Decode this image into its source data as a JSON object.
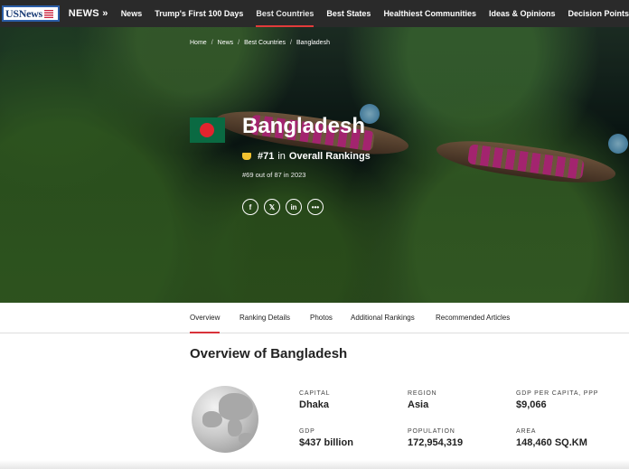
{
  "nav": {
    "logo": "USNews",
    "section": "NEWS »",
    "items": [
      {
        "label": "News",
        "active": false
      },
      {
        "label": "Trump's First 100 Days",
        "active": false
      },
      {
        "label": "Best Countries",
        "active": true
      },
      {
        "label": "Best States",
        "active": false
      },
      {
        "label": "Healthiest Communities",
        "active": false
      },
      {
        "label": "Ideas & Opinions",
        "active": false
      },
      {
        "label": "Decision Points",
        "active": false
      }
    ]
  },
  "breadcrumb": [
    "Home",
    "News",
    "Best Countries",
    "Bangladesh"
  ],
  "country": {
    "name": "Bangladesh",
    "rank": "#71",
    "rank_in": "in",
    "rank_category": "Overall Rankings",
    "previous_rank": "#69 out of 87 in 2023",
    "flag_colors": {
      "field": "#0a6a42",
      "disc": "#e2232e"
    }
  },
  "share_icons": [
    "facebook-icon",
    "x-icon",
    "linkedin-icon",
    "more-icon"
  ],
  "tabs": [
    {
      "label": "Overview",
      "active": true
    },
    {
      "label": "Ranking Details",
      "active": false
    },
    {
      "label": "Photos",
      "active": false
    },
    {
      "label": "Additional Rankings",
      "active": false
    },
    {
      "label": "Recommended Articles",
      "active": false
    }
  ],
  "overview": {
    "title": "Overview of Bangladesh",
    "stats": [
      {
        "label": "CAPITAL",
        "value": "Dhaka"
      },
      {
        "label": "REGION",
        "value": "Asia"
      },
      {
        "label": "GDP PER CAPITA, PPP",
        "value": "$9,066"
      },
      {
        "label": "GDP",
        "value": "$437 billion"
      },
      {
        "label": "POPULATION",
        "value": "172,954,319"
      },
      {
        "label": "AREA",
        "value": "148,460 SQ.KM"
      }
    ]
  },
  "colors": {
    "nav_bg": "#2a2a2a",
    "accent": "#d8323a",
    "rank_badge": "#f2c230"
  }
}
